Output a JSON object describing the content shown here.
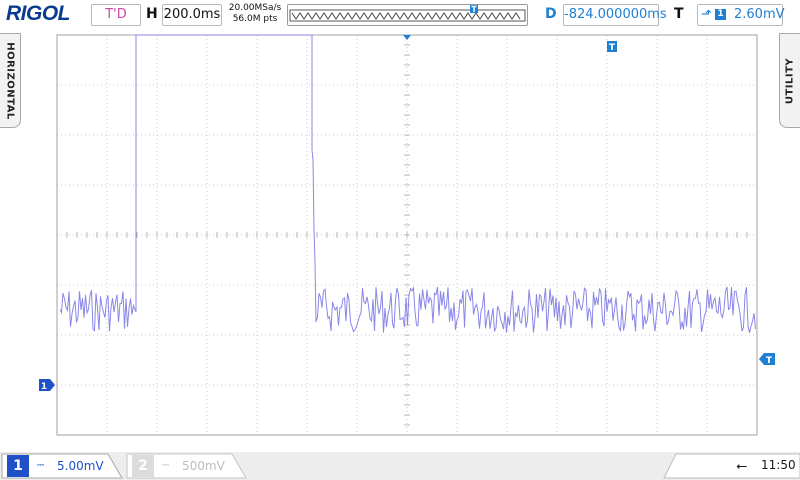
{
  "brand": "RIGOL",
  "run_status": "T'D",
  "horizontal": {
    "letter": "H",
    "timebase": "200.0ms",
    "sample_rate": "20.00MSa/s",
    "memory_depth": "56.0M pts"
  },
  "delay": {
    "letter": "D",
    "value": "-824.000000ms"
  },
  "trigger": {
    "letter": "T",
    "edge_icon": "rising-edge-icon",
    "source": "1",
    "level": "2.60mV"
  },
  "side_tabs": {
    "left": "HORIZONTAL",
    "right": "UTILITY"
  },
  "markers": {
    "trigger_position": "T",
    "channel1_ground": "1",
    "trigger_level": "T"
  },
  "channels": [
    {
      "number": "1",
      "coupling_icon": "dc-coupling-icon",
      "scale": "5.00mV",
      "active": true
    },
    {
      "number": "2",
      "coupling_icon": "dc-coupling-icon",
      "scale": "500mV",
      "active": false
    }
  ],
  "status": {
    "usb_icon": "usb-icon",
    "time": "11:50"
  },
  "colors": {
    "brand": "#0a3b8e",
    "channel1": "#8a87e8",
    "accent_blue": "#1f7fd2",
    "run_status": "#c94aa3",
    "grid": "#c8c8c8"
  }
}
